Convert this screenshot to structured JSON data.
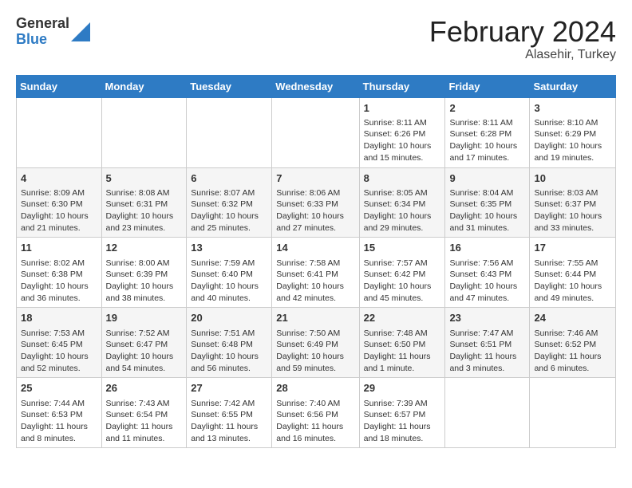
{
  "header": {
    "logo_general": "General",
    "logo_blue": "Blue",
    "month_title": "February 2024",
    "location": "Alasehir, Turkey"
  },
  "days_of_week": [
    "Sunday",
    "Monday",
    "Tuesday",
    "Wednesday",
    "Thursday",
    "Friday",
    "Saturday"
  ],
  "weeks": [
    [
      {
        "day": "",
        "info": ""
      },
      {
        "day": "",
        "info": ""
      },
      {
        "day": "",
        "info": ""
      },
      {
        "day": "",
        "info": ""
      },
      {
        "day": "1",
        "info": "Sunrise: 8:11 AM\nSunset: 6:26 PM\nDaylight: 10 hours and 15 minutes."
      },
      {
        "day": "2",
        "info": "Sunrise: 8:11 AM\nSunset: 6:28 PM\nDaylight: 10 hours and 17 minutes."
      },
      {
        "day": "3",
        "info": "Sunrise: 8:10 AM\nSunset: 6:29 PM\nDaylight: 10 hours and 19 minutes."
      }
    ],
    [
      {
        "day": "4",
        "info": "Sunrise: 8:09 AM\nSunset: 6:30 PM\nDaylight: 10 hours and 21 minutes."
      },
      {
        "day": "5",
        "info": "Sunrise: 8:08 AM\nSunset: 6:31 PM\nDaylight: 10 hours and 23 minutes."
      },
      {
        "day": "6",
        "info": "Sunrise: 8:07 AM\nSunset: 6:32 PM\nDaylight: 10 hours and 25 minutes."
      },
      {
        "day": "7",
        "info": "Sunrise: 8:06 AM\nSunset: 6:33 PM\nDaylight: 10 hours and 27 minutes."
      },
      {
        "day": "8",
        "info": "Sunrise: 8:05 AM\nSunset: 6:34 PM\nDaylight: 10 hours and 29 minutes."
      },
      {
        "day": "9",
        "info": "Sunrise: 8:04 AM\nSunset: 6:35 PM\nDaylight: 10 hours and 31 minutes."
      },
      {
        "day": "10",
        "info": "Sunrise: 8:03 AM\nSunset: 6:37 PM\nDaylight: 10 hours and 33 minutes."
      }
    ],
    [
      {
        "day": "11",
        "info": "Sunrise: 8:02 AM\nSunset: 6:38 PM\nDaylight: 10 hours and 36 minutes."
      },
      {
        "day": "12",
        "info": "Sunrise: 8:00 AM\nSunset: 6:39 PM\nDaylight: 10 hours and 38 minutes."
      },
      {
        "day": "13",
        "info": "Sunrise: 7:59 AM\nSunset: 6:40 PM\nDaylight: 10 hours and 40 minutes."
      },
      {
        "day": "14",
        "info": "Sunrise: 7:58 AM\nSunset: 6:41 PM\nDaylight: 10 hours and 42 minutes."
      },
      {
        "day": "15",
        "info": "Sunrise: 7:57 AM\nSunset: 6:42 PM\nDaylight: 10 hours and 45 minutes."
      },
      {
        "day": "16",
        "info": "Sunrise: 7:56 AM\nSunset: 6:43 PM\nDaylight: 10 hours and 47 minutes."
      },
      {
        "day": "17",
        "info": "Sunrise: 7:55 AM\nSunset: 6:44 PM\nDaylight: 10 hours and 49 minutes."
      }
    ],
    [
      {
        "day": "18",
        "info": "Sunrise: 7:53 AM\nSunset: 6:45 PM\nDaylight: 10 hours and 52 minutes."
      },
      {
        "day": "19",
        "info": "Sunrise: 7:52 AM\nSunset: 6:47 PM\nDaylight: 10 hours and 54 minutes."
      },
      {
        "day": "20",
        "info": "Sunrise: 7:51 AM\nSunset: 6:48 PM\nDaylight: 10 hours and 56 minutes."
      },
      {
        "day": "21",
        "info": "Sunrise: 7:50 AM\nSunset: 6:49 PM\nDaylight: 10 hours and 59 minutes."
      },
      {
        "day": "22",
        "info": "Sunrise: 7:48 AM\nSunset: 6:50 PM\nDaylight: 11 hours and 1 minute."
      },
      {
        "day": "23",
        "info": "Sunrise: 7:47 AM\nSunset: 6:51 PM\nDaylight: 11 hours and 3 minutes."
      },
      {
        "day": "24",
        "info": "Sunrise: 7:46 AM\nSunset: 6:52 PM\nDaylight: 11 hours and 6 minutes."
      }
    ],
    [
      {
        "day": "25",
        "info": "Sunrise: 7:44 AM\nSunset: 6:53 PM\nDaylight: 11 hours and 8 minutes."
      },
      {
        "day": "26",
        "info": "Sunrise: 7:43 AM\nSunset: 6:54 PM\nDaylight: 11 hours and 11 minutes."
      },
      {
        "day": "27",
        "info": "Sunrise: 7:42 AM\nSunset: 6:55 PM\nDaylight: 11 hours and 13 minutes."
      },
      {
        "day": "28",
        "info": "Sunrise: 7:40 AM\nSunset: 6:56 PM\nDaylight: 11 hours and 16 minutes."
      },
      {
        "day": "29",
        "info": "Sunrise: 7:39 AM\nSunset: 6:57 PM\nDaylight: 11 hours and 18 minutes."
      },
      {
        "day": "",
        "info": ""
      },
      {
        "day": "",
        "info": ""
      }
    ]
  ]
}
